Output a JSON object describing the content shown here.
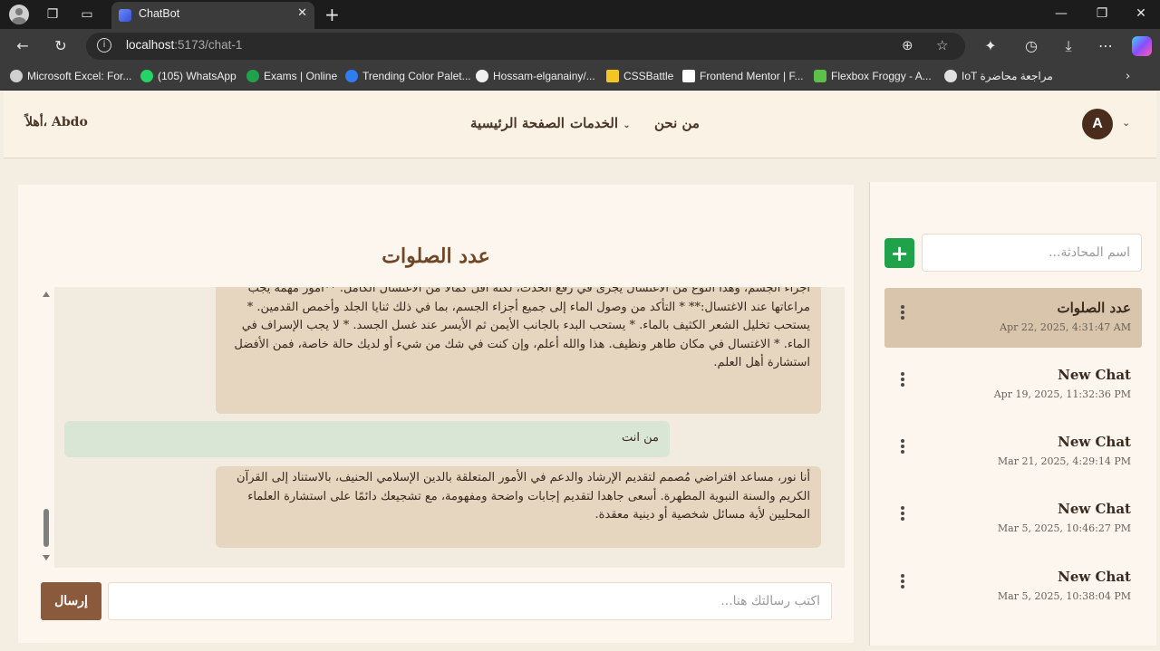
{
  "browser": {
    "tab_title": "ChatBot",
    "url_host": "localhost",
    "url_path": ":5173/chat-1",
    "bookmarks": [
      {
        "label": "Microsoft Excel: For...",
        "color": "#d0d0d0"
      },
      {
        "label": "(105) WhatsApp",
        "color": "#25d366"
      },
      {
        "label": "Exams | Online",
        "color": "#1fa24a"
      },
      {
        "label": "Trending Color Palet...",
        "color": "#2f7df0"
      },
      {
        "label": "Hossam-elganainy/...",
        "color": "#f0f0f0"
      },
      {
        "label": "CSSBattle",
        "color": "#f3c623"
      },
      {
        "label": "Frontend Mentor | F...",
        "color": "#ffffff"
      },
      {
        "label": "Flexbox Froggy - A...",
        "color": "#5cc04a"
      },
      {
        "label": "IoT مراجعة محاضرة",
        "color": "#e0e0e0"
      }
    ]
  },
  "header": {
    "greeting": "أهلاً، Abdo",
    "nav": {
      "home": "الصفحة الرئيسية",
      "services": "الخدمات",
      "about": "من نحن"
    },
    "avatar_letter": "A"
  },
  "chat": {
    "title": "عدد الصلوات",
    "messages": [
      {
        "role": "bot",
        "text": "أجزاء الجسم، وهذا النوع من الاغتسال يجزئ في رفع الحدث، لكنه أقل كمالاً من الاغتسال الكامل. **أمور مهمة يجب مراعاتها عند الاغتسال:** * التأكد من وصول الماء إلى جميع أجزاء الجسم، بما في ذلك ثنايا الجلد وأخمص القدمين. * يستحب تخليل الشعر الكثيف بالماء. * يستحب البدء بالجانب الأيمن ثم الأيسر عند غسل الجسد. * لا يجب الإسراف في الماء. * الاغتسال في مكان طاهر ونظيف. هذا والله أعلم، وإن كنت في شك من شيء أو لديك حالة خاصة، فمن الأفضل استشارة أهل العلم."
      },
      {
        "role": "user",
        "text": "من انت"
      },
      {
        "role": "bot",
        "text": "أنا نور، مساعد افتراضي مُصمم لتقديم الإرشاد والدعم في الأمور المتعلقة بالدين الإسلامي الحنيف، بالاستناد إلى القرآن الكريم والسنة النبوية المطهرة. أسعى جاهدا لتقديم إجابات واضحة ومفهومة، مع تشجيعك دائمًا على استشارة العلماء المحليين لأية مسائل شخصية أو دينية معقدة."
      }
    ],
    "input_placeholder": "اكتب رسالتك هنا...",
    "send_label": "إرسال"
  },
  "sidebar": {
    "name_placeholder": "اسم المحادثة...",
    "add_label": "+",
    "conversations": [
      {
        "title": "عدد الصلوات",
        "date": "Apr 22, 2025, 4:31:47 AM",
        "active": true
      },
      {
        "title": "New Chat",
        "date": "Apr 19, 2025, 11:32:36 PM",
        "active": false
      },
      {
        "title": "New Chat",
        "date": "Mar 21, 2025, 4:29:14 PM",
        "active": false
      },
      {
        "title": "New Chat",
        "date": "Mar 5, 2025, 10:46:27 PM",
        "active": false
      },
      {
        "title": "New Chat",
        "date": "Mar 5, 2025, 10:38:04 PM",
        "active": false
      }
    ]
  },
  "colors": {
    "accent_brown": "#8b5a3c",
    "title_brown": "#6e4726",
    "add_green": "#1fa24a",
    "active_conversation": "#d8c5ab",
    "bot_bubble": "#e6d5bf",
    "user_bubble": "#d9e6d5"
  }
}
